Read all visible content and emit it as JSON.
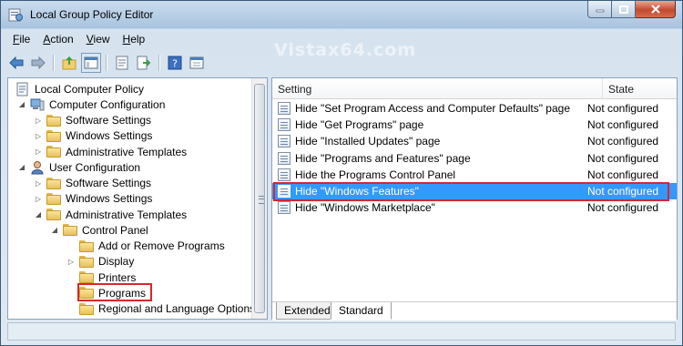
{
  "window": {
    "title": "Local Group Policy Editor"
  },
  "menu": {
    "file": "File",
    "action": "Action",
    "view": "View",
    "help": "Help"
  },
  "watermark": "Vistax64.com",
  "tree": [
    {
      "label": "Local Computer Policy",
      "level": 0,
      "icon": "policy-icon",
      "expander": "none"
    },
    {
      "label": "Computer Configuration",
      "level": 1,
      "icon": "computer-icon",
      "expander": "expanded"
    },
    {
      "label": "Software Settings",
      "level": 2,
      "icon": "folder-icon",
      "expander": "collapsed"
    },
    {
      "label": "Windows Settings",
      "level": 2,
      "icon": "folder-icon",
      "expander": "collapsed"
    },
    {
      "label": "Administrative Templates",
      "level": 2,
      "icon": "folder-icon",
      "expander": "collapsed"
    },
    {
      "label": "User Configuration",
      "level": 1,
      "icon": "user-icon",
      "expander": "expanded"
    },
    {
      "label": "Software Settings",
      "level": 2,
      "icon": "folder-icon",
      "expander": "collapsed"
    },
    {
      "label": "Windows Settings",
      "level": 2,
      "icon": "folder-icon",
      "expander": "collapsed"
    },
    {
      "label": "Administrative Templates",
      "level": 2,
      "icon": "folder-icon",
      "expander": "expanded"
    },
    {
      "label": "Control Panel",
      "level": 3,
      "icon": "folder-icon",
      "expander": "expanded"
    },
    {
      "label": "Add or Remove Programs",
      "level": 4,
      "icon": "folder-icon",
      "expander": "none"
    },
    {
      "label": "Display",
      "level": 4,
      "icon": "folder-icon",
      "expander": "collapsed"
    },
    {
      "label": "Printers",
      "level": 4,
      "icon": "folder-icon",
      "expander": "none"
    },
    {
      "label": "Programs",
      "level": 4,
      "icon": "folder-icon",
      "expander": "none",
      "highlighted": true
    },
    {
      "label": "Regional and Language Options",
      "level": 4,
      "icon": "folder-icon",
      "expander": "none"
    }
  ],
  "list": {
    "headers": {
      "setting": "Setting",
      "state": "State"
    },
    "rows": [
      {
        "name": "Hide \"Set Program Access and Computer Defaults\" page",
        "state": "Not configured"
      },
      {
        "name": "Hide \"Get Programs\" page",
        "state": "Not configured"
      },
      {
        "name": "Hide \"Installed Updates\" page",
        "state": "Not configured"
      },
      {
        "name": "Hide \"Programs and Features\" page",
        "state": "Not configured"
      },
      {
        "name": "Hide the Programs Control Panel",
        "state": "Not configured"
      },
      {
        "name": "Hide \"Windows Features\"",
        "state": "Not configured",
        "selected": true
      },
      {
        "name": "Hide \"Windows Marketplace\"",
        "state": "Not configured"
      }
    ]
  },
  "tabs": [
    {
      "label": "Extended"
    },
    {
      "label": "Standard",
      "active": true
    }
  ],
  "colors": {
    "selection": "#3399ff",
    "highlight_box": "#d9262e"
  }
}
